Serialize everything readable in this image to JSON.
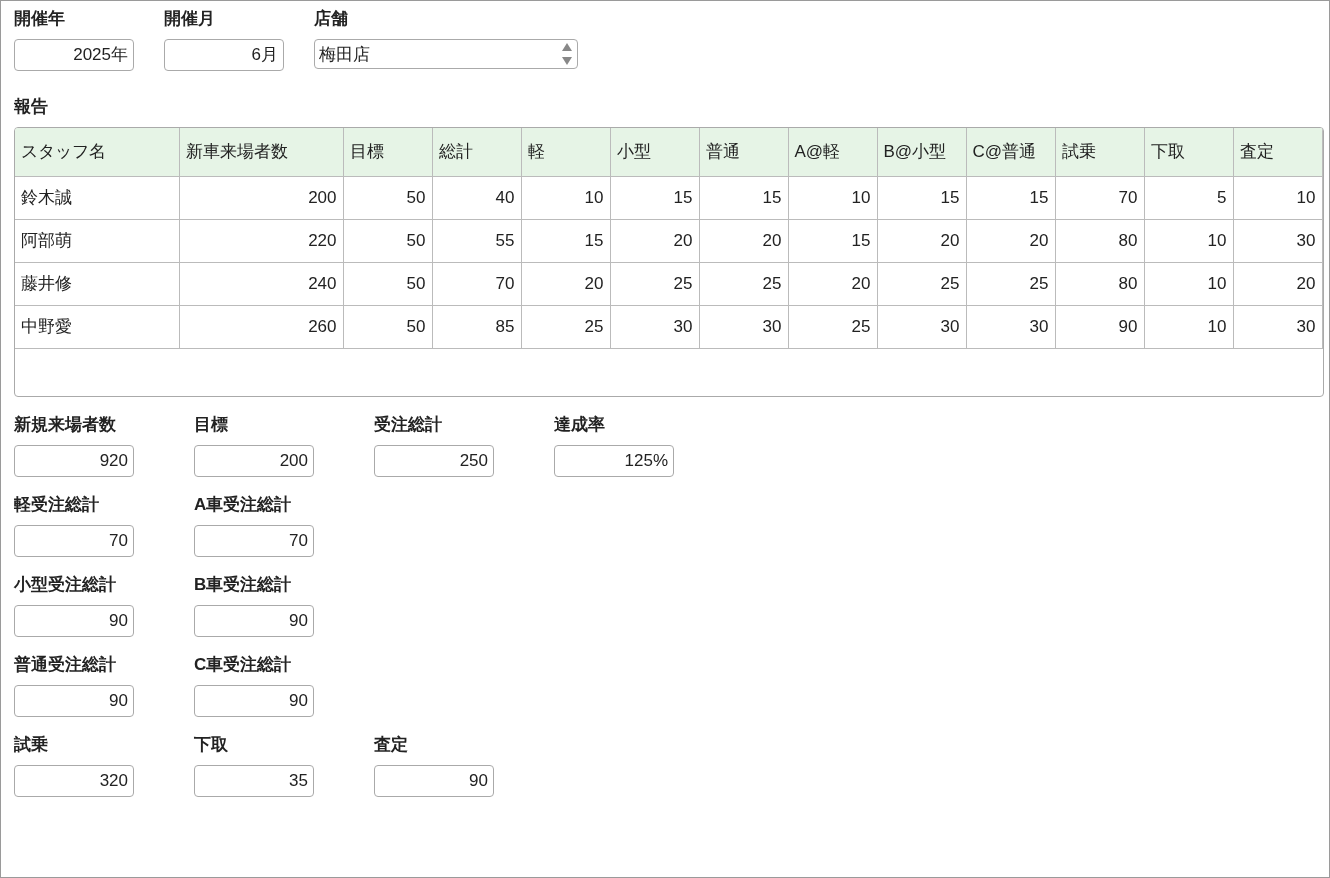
{
  "filters": [
    {
      "kind": "field",
      "label": "開催年",
      "value": "2025年"
    },
    {
      "kind": "field",
      "label": "開催月",
      "value": "6月"
    },
    {
      "kind": "select",
      "label": "店舗",
      "value": "梅田店"
    }
  ],
  "report": {
    "title": "報告",
    "columns": [
      "スタッフ名",
      "新車来場者数",
      "目標",
      "総計",
      "軽",
      "小型",
      "普通",
      "A@軽",
      "B@小型",
      "C@普通",
      "試乗",
      "下取",
      "査定"
    ],
    "rows": [
      [
        "鈴木誠",
        "200",
        "50",
        "40",
        "10",
        "15",
        "15",
        "10",
        "15",
        "15",
        "70",
        "5",
        "10"
      ],
      [
        "阿部萌",
        "220",
        "50",
        "55",
        "15",
        "20",
        "20",
        "15",
        "20",
        "20",
        "80",
        "10",
        "30"
      ],
      [
        "藤井修",
        "240",
        "50",
        "70",
        "20",
        "25",
        "25",
        "20",
        "25",
        "25",
        "80",
        "10",
        "20"
      ],
      [
        "中野愛",
        "260",
        "50",
        "85",
        "25",
        "30",
        "30",
        "25",
        "30",
        "30",
        "90",
        "10",
        "30"
      ]
    ]
  },
  "summary_rows": [
    [
      {
        "label": "新規来場者数",
        "value": "920"
      },
      {
        "label": "目標",
        "value": "200"
      },
      {
        "label": "受注総計",
        "value": "250"
      },
      {
        "label": "達成率",
        "value": "125%"
      }
    ],
    [
      {
        "label": "軽受注総計",
        "value": "70"
      },
      {
        "label": "A車受注総計",
        "value": "70"
      }
    ],
    [
      {
        "label": "小型受注総計",
        "value": "90"
      },
      {
        "label": "B車受注総計",
        "value": "90"
      }
    ],
    [
      {
        "label": "普通受注総計",
        "value": "90"
      },
      {
        "label": "C車受注総計",
        "value": "90"
      }
    ],
    [
      {
        "label": "試乗",
        "value": "320"
      },
      {
        "label": "下取",
        "value": "35"
      },
      {
        "label": "査定",
        "value": "90"
      }
    ]
  ]
}
